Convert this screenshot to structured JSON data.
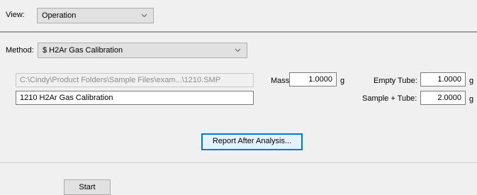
{
  "view": {
    "label": "View:",
    "selected": "Operation"
  },
  "method": {
    "label": "Method:",
    "selected": "$ H2Ar Gas Calibration"
  },
  "file_path": "C:\\Cindy\\Product Folders\\Sample Files\\exam...\\1210.SMP",
  "sample_name": "1210 H2Ar Gas Calibration",
  "mass": {
    "label": "Mass:",
    "value": "1.0000",
    "unit": "g"
  },
  "empty_tube": {
    "label": "Empty Tube:",
    "value": "1.0000",
    "unit": "g"
  },
  "sample_tube": {
    "label": "Sample + Tube:",
    "value": "2.0000",
    "unit": "g"
  },
  "report_button": "Report After Analysis...",
  "start_button": "Start"
}
